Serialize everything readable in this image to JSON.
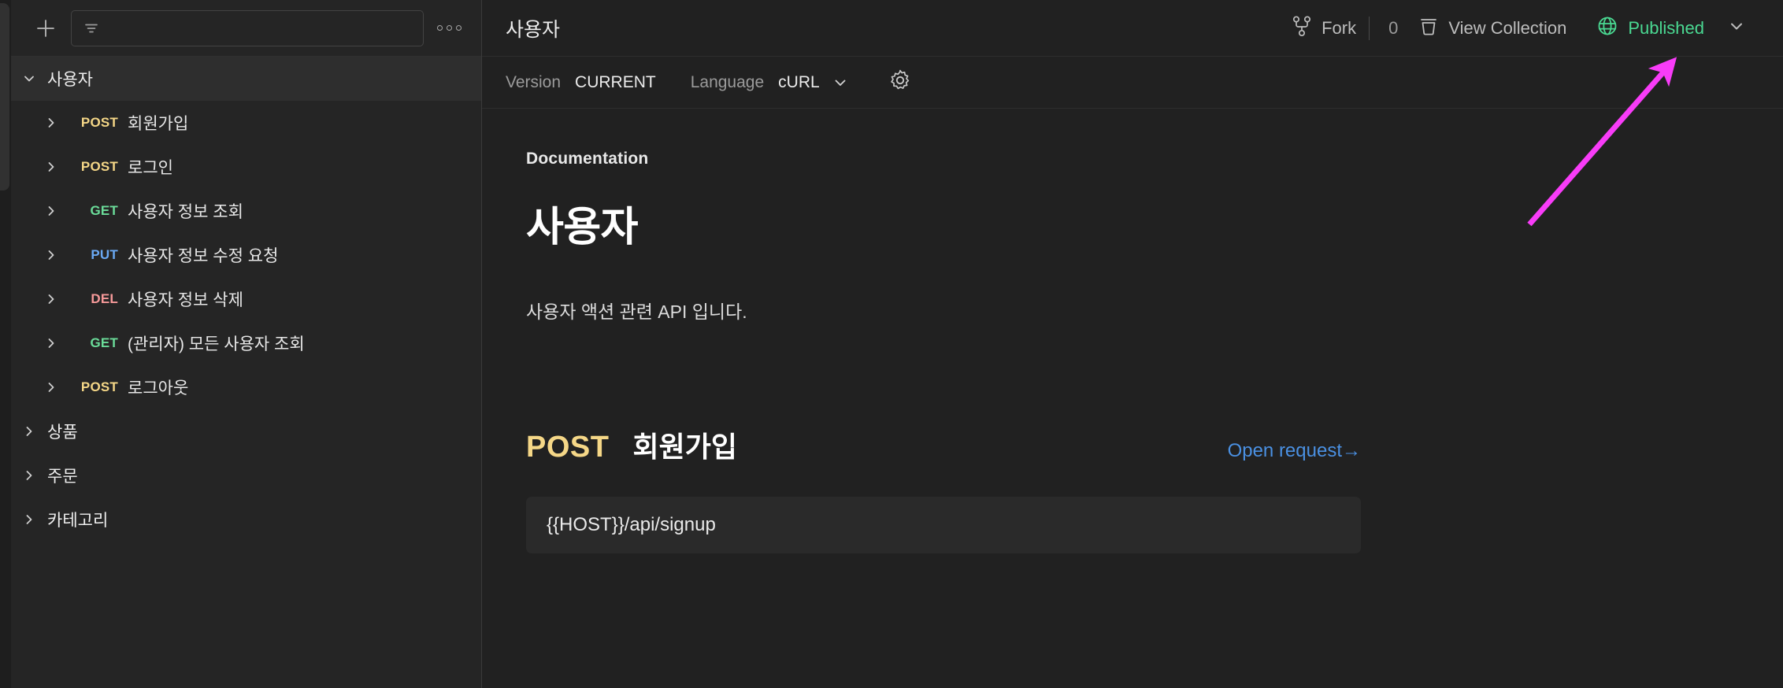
{
  "sidebar": {
    "add_label": "+",
    "filter": {
      "value": "",
      "placeholder": ""
    },
    "more_label": "more-options",
    "tree": [
      {
        "type": "folder",
        "label": "사용자",
        "expanded": true,
        "selected": true
      },
      {
        "type": "request",
        "method": "POST",
        "method_key": "post",
        "label": "회원가입"
      },
      {
        "type": "request",
        "method": "POST",
        "method_key": "post",
        "label": "로그인"
      },
      {
        "type": "request",
        "method": "GET",
        "method_key": "get",
        "label": "사용자 정보 조회"
      },
      {
        "type": "request",
        "method": "PUT",
        "method_key": "put",
        "label": "사용자 정보 수정 요청"
      },
      {
        "type": "request",
        "method": "DEL",
        "method_key": "del",
        "label": "사용자 정보 삭제"
      },
      {
        "type": "request",
        "method": "GET",
        "method_key": "get",
        "label": "(관리자) 모든 사용자 조회"
      },
      {
        "type": "request",
        "method": "POST",
        "method_key": "post",
        "label": "로그아웃"
      },
      {
        "type": "folder",
        "label": "상품",
        "expanded": false,
        "selected": false
      },
      {
        "type": "folder",
        "label": "주문",
        "expanded": false,
        "selected": false
      },
      {
        "type": "folder",
        "label": "카테고리",
        "expanded": false,
        "selected": false
      }
    ]
  },
  "header": {
    "title": "사용자",
    "fork_label": "Fork",
    "fork_count": "0",
    "view_collection_label": "View Collection",
    "published_label": "Published",
    "published_color": "#4ad992"
  },
  "toolbar": {
    "version_label": "Version",
    "version_value": "CURRENT",
    "language_label": "Language",
    "language_value": "cURL",
    "settings_label": "settings"
  },
  "doc": {
    "kicker": "Documentation",
    "title": "사용자",
    "description": "사용자 액션 관련 API 입니다.",
    "request": {
      "method": "POST",
      "name": "회원가입",
      "open_request_label": "Open request→",
      "url": "{{HOST}}/api/signup"
    }
  },
  "annotation": {
    "arrow_color": "#f83cf8",
    "points_at": "Published"
  },
  "colors": {
    "post": "#f5d787",
    "get": "#6bdd9a",
    "put": "#6aa9f4",
    "del": "#f79a9a",
    "link": "#4a90e2"
  }
}
